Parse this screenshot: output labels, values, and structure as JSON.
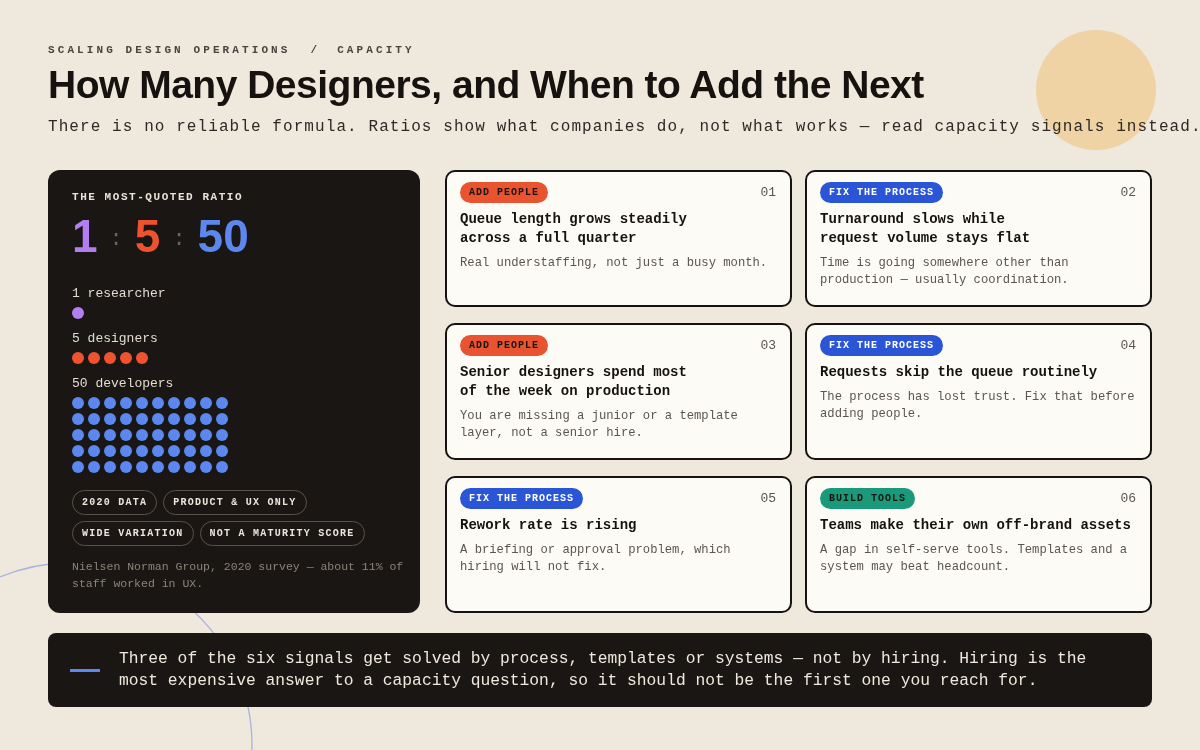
{
  "header": {
    "breadcrumb": [
      "SCALING DESIGN OPERATIONS",
      "CAPACITY"
    ],
    "separator": "/",
    "title": "How Many Designers, and When to Add the Next",
    "subtitle": "There is no reliable formula. Ratios show what companies do, not what works — read capacity signals instead."
  },
  "ratio_card": {
    "heading": "THE MOST-QUOTED RATIO",
    "ratio": [
      {
        "kind": "number",
        "text": "1",
        "color": "#b27ff0"
      },
      {
        "kind": "separator",
        "text": ":"
      },
      {
        "kind": "number",
        "text": "5",
        "color": "#ee5330"
      },
      {
        "kind": "separator",
        "text": ":"
      },
      {
        "kind": "number",
        "text": "50",
        "color": "#5b87ef"
      }
    ],
    "groups": [
      {
        "label": "1 researcher",
        "dots": [
          {
            "color": "#b27ff0"
          }
        ]
      },
      {
        "label": "5 designers",
        "dots": [
          {
            "color": "#ee5330"
          },
          {
            "color": "#ee5330"
          },
          {
            "color": "#ee5330"
          },
          {
            "color": "#ee5330"
          },
          {
            "color": "#ee5330"
          }
        ]
      },
      {
        "label": "50 developers",
        "dots": [
          {
            "color": "#5b87ef"
          },
          {
            "color": "#5b87ef"
          },
          {
            "color": "#5b87ef"
          },
          {
            "color": "#5b87ef"
          },
          {
            "color": "#5b87ef"
          },
          {
            "color": "#5b87ef"
          },
          {
            "color": "#5b87ef"
          },
          {
            "color": "#5b87ef"
          },
          {
            "color": "#5b87ef"
          },
          {
            "color": "#5b87ef"
          },
          {
            "color": "#5b87ef"
          },
          {
            "color": "#5b87ef"
          },
          {
            "color": "#5b87ef"
          },
          {
            "color": "#5b87ef"
          },
          {
            "color": "#5b87ef"
          },
          {
            "color": "#5b87ef"
          },
          {
            "color": "#5b87ef"
          },
          {
            "color": "#5b87ef"
          },
          {
            "color": "#5b87ef"
          },
          {
            "color": "#5b87ef"
          },
          {
            "color": "#5b87ef"
          },
          {
            "color": "#5b87ef"
          },
          {
            "color": "#5b87ef"
          },
          {
            "color": "#5b87ef"
          },
          {
            "color": "#5b87ef"
          },
          {
            "color": "#5b87ef"
          },
          {
            "color": "#5b87ef"
          },
          {
            "color": "#5b87ef"
          },
          {
            "color": "#5b87ef"
          },
          {
            "color": "#5b87ef"
          },
          {
            "color": "#5b87ef"
          },
          {
            "color": "#5b87ef"
          },
          {
            "color": "#5b87ef"
          },
          {
            "color": "#5b87ef"
          },
          {
            "color": "#5b87ef"
          },
          {
            "color": "#5b87ef"
          },
          {
            "color": "#5b87ef"
          },
          {
            "color": "#5b87ef"
          },
          {
            "color": "#5b87ef"
          },
          {
            "color": "#5b87ef"
          },
          {
            "color": "#5b87ef"
          },
          {
            "color": "#5b87ef"
          },
          {
            "color": "#5b87ef"
          },
          {
            "color": "#5b87ef"
          },
          {
            "color": "#5b87ef"
          },
          {
            "color": "#5b87ef"
          },
          {
            "color": "#5b87ef"
          },
          {
            "color": "#5b87ef"
          },
          {
            "color": "#5b87ef"
          },
          {
            "color": "#5b87ef"
          }
        ]
      }
    ],
    "tags": [
      "2020 DATA",
      "PRODUCT & UX ONLY",
      "WIDE VARIATION",
      "NOT A MATURITY SCORE"
    ],
    "note": "Nielsen Norman Group, 2020 survey — about 11% of staff worked in UX."
  },
  "signals": [
    {
      "number": "01",
      "tag": {
        "label": "ADD PEOPLE",
        "color": "#e9532f"
      },
      "title": "Queue length grows steadily across a full quarter",
      "description": "Real understaffing, not just a busy month."
    },
    {
      "number": "02",
      "tag": {
        "label": "FIX THE PROCESS",
        "color": "#2a55d6"
      },
      "title": "Turnaround slows while request volume stays flat",
      "description": "Time is going somewhere other than production — usually coordination."
    },
    {
      "number": "03",
      "tag": {
        "label": "ADD PEOPLE",
        "color": "#e9532f"
      },
      "title": "Senior designers spend most of the week on production",
      "description": "You are missing a junior or a template layer, not a senior hire."
    },
    {
      "number": "04",
      "tag": {
        "label": "FIX THE PROCESS",
        "color": "#2a55d6"
      },
      "title": "Requests skip the queue routinely",
      "description": "The process has lost trust. Fix that before adding people."
    },
    {
      "number": "05",
      "tag": {
        "label": "FIX THE PROCESS",
        "color": "#2a55d6"
      },
      "title": "Rework rate is rising",
      "description": "A briefing or approval problem, which hiring will not fix."
    },
    {
      "number": "06",
      "tag": {
        "label": "BUILD TOOLS",
        "color": "#1a9a7a"
      },
      "title": "Teams make their own off-brand assets",
      "description": "A gap in self-serve tools. Templates and a system may beat headcount."
    }
  ],
  "callout": "Three of the six signals get solved by process, templates or systems — not by hiring. Hiring is the most expensive answer to a capacity question, so it should not be the first one you reach for."
}
